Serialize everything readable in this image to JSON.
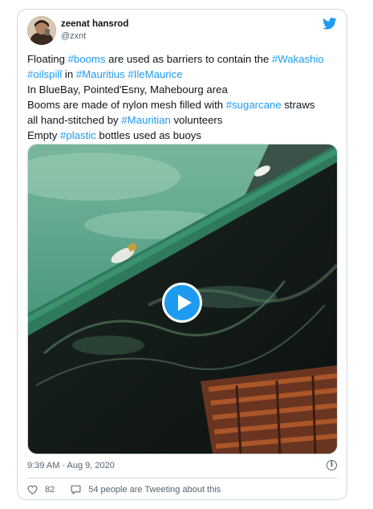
{
  "tweet": {
    "author_name": "zeenat hansrod",
    "author_handle": "@zxnt",
    "lines": [
      [
        {
          "t": "Floating ",
          "tag": false
        },
        {
          "t": "#booms",
          "tag": true
        },
        {
          "t": " are used as barriers to contain the ",
          "tag": false
        },
        {
          "t": "#Wakashio",
          "tag": true
        }
      ],
      [
        {
          "t": "#oilspill",
          "tag": true
        },
        {
          "t": " in ",
          "tag": false
        },
        {
          "t": "#Mauritius",
          "tag": true
        },
        {
          "t": " ",
          "tag": false
        },
        {
          "t": "#IleMaurice",
          "tag": true
        }
      ],
      [
        {
          "t": "In BlueBay, Pointed'Esny, Mahebourg area",
          "tag": false
        }
      ],
      [
        {
          "t": "Booms are made of nylon mesh filled with ",
          "tag": false
        },
        {
          "t": "#sugarcane",
          "tag": true
        },
        {
          "t": " straws",
          "tag": false
        }
      ],
      [
        {
          "t": "all hand-stitched by ",
          "tag": false
        },
        {
          "t": "#Mauritian",
          "tag": true
        },
        {
          "t": " volunteers",
          "tag": false
        }
      ],
      [
        {
          "t": "Empty ",
          "tag": false
        },
        {
          "t": "#plastic",
          "tag": true
        },
        {
          "t": " bottles used as buoys",
          "tag": false
        }
      ]
    ],
    "timestamp": "9:39 AM · Aug 9, 2020",
    "likes": "82",
    "tweeting_text": "54 people are Tweeting about this"
  },
  "icons": {
    "brand": "twitter-bird-icon",
    "play": "play-icon",
    "info": "info-icon",
    "like": "heart-icon",
    "reply": "speech-bubble-icon"
  },
  "colors": {
    "accent": "#1d9bf0",
    "text": "#0f1419",
    "muted": "#536471",
    "border": "#cfd9de"
  }
}
